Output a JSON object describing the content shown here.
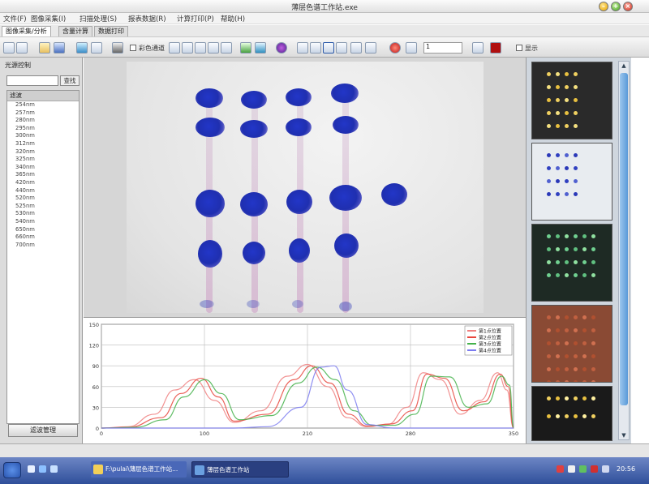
{
  "window": {
    "title": "薄层色谱工作站.exe"
  },
  "menu": [
    "文件(F)",
    "图像采集(I)",
    "扫描处理(S)",
    "报表数据(R)",
    "计算打印(P)",
    "帮助(H)"
  ],
  "tabs": [
    "图像采集/分析",
    "含量计算",
    "数据打印"
  ],
  "toolbar": {
    "checkbox1_label": "彩色通道",
    "input_value": "1",
    "checkbox2_label": "显示"
  },
  "left_panel": {
    "title": "光源控制",
    "search_button": "查找",
    "list_header": "滤波",
    "filters": [
      "254nm",
      "257nm",
      "280nm",
      "295nm",
      "300nm",
      "312nm",
      "320nm",
      "325nm",
      "340nm",
      "365nm",
      "420nm",
      "440nm",
      "520nm",
      "525nm",
      "530nm",
      "540nm",
      "650nm",
      "660nm",
      "700nm"
    ],
    "manage_button": "滤波管理"
  },
  "colors": {
    "spot": "#1f2fb0",
    "series": [
      "#f08080",
      "#e8453c",
      "#44b24a",
      "#7b7bf0"
    ],
    "taskbar": "#3a5aa8"
  },
  "chart_data": {
    "type": "line",
    "x_range": [
      0,
      310
    ],
    "ylim": [
      0,
      150
    ],
    "x_ticks": [
      "0",
      "100",
      "210",
      "280",
      "350"
    ],
    "y_ticks": [
      "0",
      "30",
      "60",
      "90",
      "120",
      "150"
    ],
    "grid": true,
    "legend_position": "top-right",
    "series": [
      {
        "name": "第1点位置",
        "x": [
          0,
          20,
          40,
          55,
          70,
          85,
          100,
          120,
          140,
          155,
          170,
          185,
          200,
          215,
          230,
          242,
          255,
          270,
          285,
          298,
          305,
          310
        ],
        "y": [
          0,
          2,
          20,
          55,
          70,
          40,
          8,
          25,
          75,
          92,
          60,
          15,
          2,
          5,
          30,
          80,
          70,
          20,
          40,
          80,
          55,
          0
        ]
      },
      {
        "name": "第2点位置",
        "x": [
          0,
          20,
          45,
          60,
          75,
          88,
          100,
          125,
          145,
          158,
          172,
          186,
          200,
          218,
          234,
          245,
          258,
          272,
          288,
          300,
          306,
          310
        ],
        "y": [
          0,
          1,
          15,
          50,
          72,
          45,
          10,
          20,
          70,
          90,
          65,
          20,
          3,
          6,
          25,
          78,
          72,
          25,
          38,
          78,
          60,
          0
        ]
      },
      {
        "name": "第3点位置",
        "x": [
          0,
          25,
          48,
          62,
          78,
          90,
          104,
          128,
          148,
          162,
          176,
          190,
          204,
          220,
          236,
          248,
          262,
          276,
          290,
          301,
          307,
          310
        ],
        "y": [
          0,
          1,
          12,
          45,
          70,
          50,
          12,
          18,
          65,
          88,
          70,
          25,
          4,
          4,
          20,
          75,
          74,
          30,
          35,
          75,
          62,
          0
        ]
      },
      {
        "name": "第4点位置",
        "x": [
          0,
          100,
          125,
          150,
          165,
          175,
          185,
          200,
          220,
          310
        ],
        "y": [
          0,
          0,
          2,
          30,
          88,
          90,
          55,
          5,
          0,
          0
        ]
      }
    ]
  },
  "taskbar": {
    "tasks": [
      "F:\\pulai\\薄层色谱工作站...",
      "薄层色谱工作站"
    ],
    "clock": "20:56"
  }
}
